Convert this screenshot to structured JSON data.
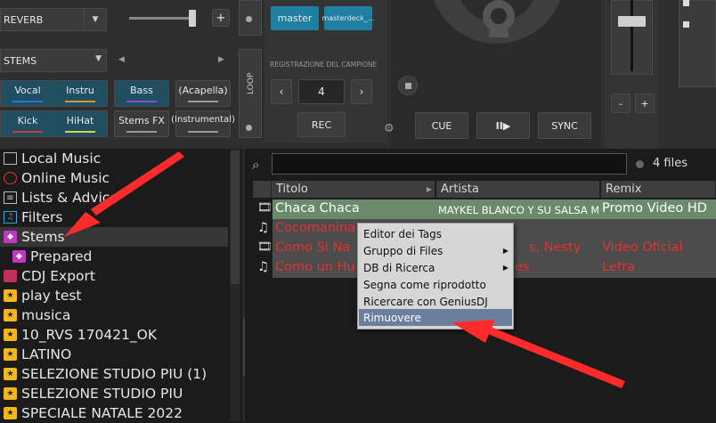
{
  "fx": {
    "select_value": "REVERB",
    "add_label": "+"
  },
  "stems": {
    "select_value": "STEMS",
    "pads": [
      {
        "label": "Vocal",
        "color": "#2f6fd6"
      },
      {
        "label": "Instru",
        "color": "#e0942c"
      },
      {
        "label": "Bass",
        "color": "#8a4fd6"
      },
      {
        "label": "(Acapella)",
        "color": "#9a9a9a"
      },
      {
        "label": "Kick",
        "color": "#d23a3a"
      },
      {
        "label": "HiHat",
        "color": "#d8d04a"
      },
      {
        "label": "Stems FX",
        "color": "#9a9a9a"
      },
      {
        "label": "(Instrumental)",
        "color": "#9a9a9a"
      }
    ]
  },
  "loop": {
    "label": "LOOP"
  },
  "sampler": {
    "master_label": "master",
    "deck_label": "masterdeck_...",
    "rec_title": "REGISTRAZIONE DEL CAMPIONE",
    "value": "4",
    "rec_label": "REC"
  },
  "transport": {
    "cue": "CUE",
    "play": "II▶",
    "sync": "SYNC"
  },
  "mixer": {
    "minus": "-",
    "plus": "+"
  },
  "sidebar": {
    "items": [
      {
        "label": "Local Music",
        "icon": "computer-icon"
      },
      {
        "label": "Online Music",
        "icon": "globe-icon"
      },
      {
        "label": "Lists & Advice",
        "icon": "list-icon"
      },
      {
        "label": "Filters",
        "icon": "filter-icon"
      },
      {
        "label": "Stems",
        "icon": "stems-icon",
        "selected": true
      },
      {
        "label": "Prepared",
        "icon": "stems-icon"
      },
      {
        "label": "CDJ Export",
        "icon": "cdj-icon"
      },
      {
        "label": "play test",
        "icon": "star-folder-icon"
      },
      {
        "label": "musica",
        "icon": "star-folder-icon"
      },
      {
        "label": "10_RVS 170421_OK",
        "icon": "star-folder-icon"
      },
      {
        "label": "LATINO",
        "icon": "star-folder-icon"
      },
      {
        "label": "SELEZIONE STUDIO PIU (1)",
        "icon": "star-folder-icon"
      },
      {
        "label": "SELEZIONE STUDIO PIU",
        "icon": "star-folder-icon"
      },
      {
        "label": "SPECIALE NATALE 2022",
        "icon": "star-folder-icon"
      }
    ],
    "folders_tab": "folders"
  },
  "browser": {
    "search_value": "",
    "file_count": "4 files",
    "columns": [
      "Titolo",
      "Artista",
      "Remix"
    ],
    "rows": [
      {
        "type": "video",
        "title": "Chaca Chaca",
        "artist": "MAYKEL BLANCO Y SU SALSA MAYOR",
        "remix": "Promo Video HD"
      },
      {
        "type": "audio",
        "title": "Cocomanina",
        "artist": "",
        "remix": ""
      },
      {
        "type": "video",
        "title": "Como Si Na",
        "artist": "s, Nesty",
        "remix": "Video Oficial"
      },
      {
        "type": "audio",
        "title": "Como un Hu",
        "artist": "es",
        "remix": "Letra"
      }
    ]
  },
  "context_menu": {
    "items": [
      {
        "label": "Editor dei Tags",
        "submenu": false
      },
      {
        "label": "Gruppo di Files",
        "submenu": true
      },
      {
        "label": "DB di Ricerca",
        "submenu": true
      },
      {
        "label": "Segna come riprodotto",
        "submenu": false
      },
      {
        "label": "Ricercare con GeniusDJ",
        "submenu": false
      },
      {
        "label": "Rimuovere",
        "submenu": false,
        "highlighted": true
      }
    ]
  },
  "colors": {
    "accent_teal": "#1e7fa0",
    "track_red": "#e23232",
    "selected_row": "#6b8a6b",
    "arrow_red": "#ff2a2a"
  }
}
